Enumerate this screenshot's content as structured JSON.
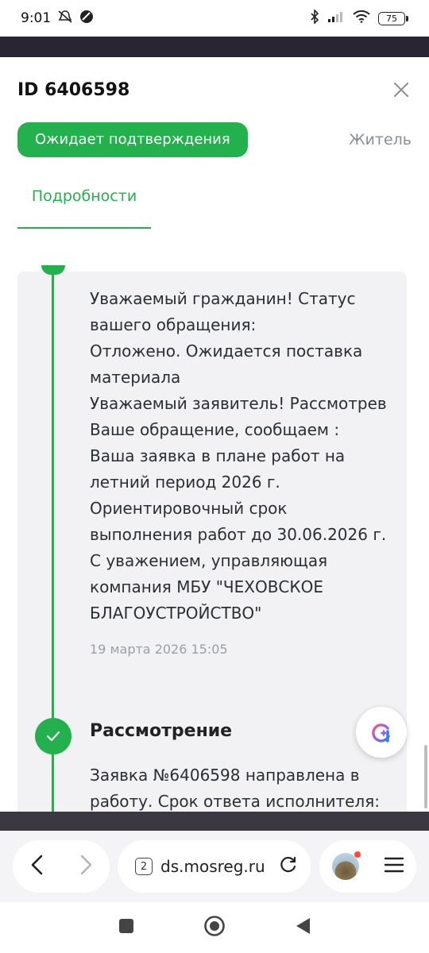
{
  "status_bar": {
    "time": "9:01",
    "battery": "75"
  },
  "header": {
    "request_id": "ID 6406598"
  },
  "status": {
    "chip_label": "Ожидает подтверждения",
    "role_label": "Житель"
  },
  "tabs": {
    "details_label": "Подробности"
  },
  "timeline": {
    "message_lines": [
      "Уважаемый гражданин! Статус",
      "вашего обращения:",
      "Отложено. Ожидается поставка",
      "материала",
      "Уважаемый заявитель! Рассмотрев",
      "Ваше обращение, сообщаем :",
      "Ваша заявка в плане работ на",
      "летний период 2026 г.",
      "Ориентировочный срок",
      "выполнения работ до 30.06.2026 г.",
      "С уважением, управляющая",
      "компания МБУ \"ЧЕХОВСКОЕ",
      "БЛАГОУСТРОЙСТВО\""
    ],
    "message_date": "19 марта 2026 15:05",
    "step_title": "Рассмотрение",
    "step_lines": [
      "Заявка №6406598 направлена в",
      "работу. Срок ответа исполнителя:"
    ]
  },
  "browser": {
    "tab_count": "2",
    "url": "ds.mosreg.ru"
  },
  "colors": {
    "accent": "#22b14c",
    "muted": "#8a8f95",
    "card_bg": "#f2f2f4"
  },
  "icons": {
    "close": "close-icon",
    "check": "check-icon",
    "assistant": "assistant-icon",
    "back": "arrow-left-icon",
    "forward": "arrow-right-icon",
    "reload": "reload-icon",
    "menu": "hamburger-menu-icon"
  }
}
